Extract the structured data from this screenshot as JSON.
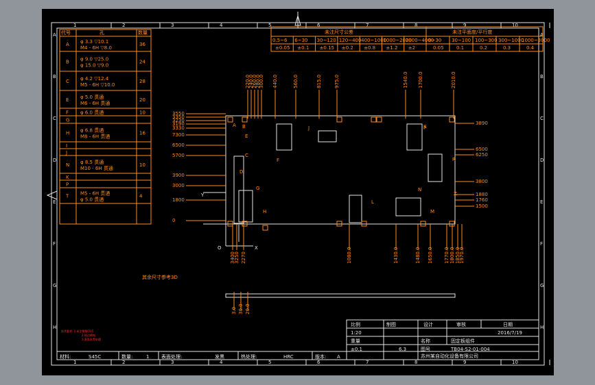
{
  "border": {
    "top_numbers": [
      "1",
      "2",
      "3",
      "4",
      "5",
      "6",
      "7",
      "8",
      "9",
      "10"
    ],
    "side_letters": [
      "A",
      "B",
      "C",
      "D",
      "E",
      "F",
      "G",
      "H"
    ]
  },
  "hole_table": {
    "header": [
      "代号",
      "孔",
      "数量"
    ],
    "rows": [
      {
        "code": "A",
        "spec1": "φ 3.3  ▽10.1",
        "spec2": "M4 - 6H ▽8.0",
        "qty": "36"
      },
      {
        "code": "B",
        "spec1": "φ 9.0  ▽25.0",
        "spec2": "φ 15.0  ▽9.0",
        "qty": "24"
      },
      {
        "code": "C",
        "spec1": "φ 4.2  ▽12.4",
        "spec2": "M5 - 6H ▽10.0",
        "qty": "28"
      },
      {
        "code": "E",
        "spec1": "φ 5.0  贯通",
        "spec2": "M6 - 6H 贯通",
        "qty": "20"
      },
      {
        "code": "F",
        "spec1": "φ 6.0  贯通",
        "spec2": "",
        "qty": "10"
      },
      {
        "code": "G",
        "spec1": "",
        "spec2": "",
        "qty": ""
      },
      {
        "code": "H",
        "spec1": "φ 6.8  贯通",
        "spec2": "M8 - 6H 贯通",
        "qty": "16"
      },
      {
        "code": "I",
        "spec1": "",
        "spec2": "",
        "qty": ""
      },
      {
        "code": "J",
        "spec1": "",
        "spec2": "",
        "qty": ""
      },
      {
        "code": "N",
        "spec1": "φ 8.5  贯通",
        "spec2": "M10 - 6H 贯通",
        "qty": "10"
      },
      {
        "code": "K",
        "spec1": "",
        "spec2": "",
        "qty": ""
      },
      {
        "code": "P",
        "spec1": "",
        "spec2": "",
        "qty": ""
      },
      {
        "code": "T",
        "spec1": "M5 - 6H 贯通",
        "spec2": "φ 5.0  贯通",
        "qty": "4"
      }
    ]
  },
  "tolerance_table": {
    "title1": "未注尺寸公差",
    "title2": "未注平面度/平行度",
    "ranges1": [
      "0.5~6",
      "6~30",
      "30~120",
      "120~400",
      "400~1000",
      "1000~2000",
      "2000~4000"
    ],
    "values1": [
      "±0.05",
      "±0.1",
      "±0.15",
      "±0.2",
      "±0.8",
      "±1.2",
      "±2"
    ],
    "ranges2": [
      "0~30",
      "30~100",
      "100~300",
      "300~1000",
      "1000~3000"
    ],
    "values2": [
      "0.05",
      "0.1",
      "0.2",
      "0.3",
      "0.4"
    ]
  },
  "plan_view": {
    "top_dims": [
      "220.0",
      "240.0",
      "260.0",
      "280.0",
      "300.0",
      "440.0",
      "560.0",
      "815.0",
      "975.0",
      "1540.0",
      "1700.0",
      "2010.0"
    ],
    "left_dims": [
      "3550",
      "3350",
      "3230",
      "3190",
      "3330",
      "7300",
      "6500",
      "5700",
      "3900",
      "3000",
      "1800",
      "0"
    ],
    "right_dims": [
      "3890",
      "6500",
      "6250",
      "3800",
      "1880",
      "1760",
      "1500"
    ],
    "bottom_dims": [
      "3400",
      "3250",
      "2270",
      "1080.0",
      "1430.0",
      "1480.0",
      "1650.0",
      "1770.0",
      "1800.0",
      "1850.0",
      "1970.0"
    ],
    "letters": [
      "A",
      "B",
      "C",
      "D",
      "E",
      "F",
      "G",
      "H",
      "J",
      "K",
      "L",
      "M",
      "N",
      "P",
      "R",
      "Z",
      "Y",
      "O",
      "X"
    ]
  },
  "side_view": {
    "dims": [
      "3.0",
      "30.0",
      "20.0"
    ]
  },
  "notes": {
    "ref_note": "其余尺寸参考3D",
    "red_notes": [
      "技术要求: 1.未注倒角C0.5",
      "2.锐边倒钝",
      "3.表面发黑处理"
    ]
  },
  "title_block": {
    "scale_label": "比例",
    "scale_value": "1:20",
    "draw_label": "制图",
    "check_label": "设计",
    "review_label": "审核",
    "date_label": "日期",
    "date_value": "2016/7/19",
    "weight_label": "重量",
    "name_label": "名称",
    "name_value": "固定板组件",
    "drawing_no_label": "图号",
    "drawing_no_value": "TB04-S2-01-004",
    "company": "苏州某自动化设备有限公司",
    "material_label": "材料:",
    "material_value": "S45C",
    "qty_label": "数量:",
    "qty_value": "1",
    "surface_label": "表面处理:",
    "surface_value": "发黑",
    "heat_label": "热处理:",
    "heat_value": "HRC",
    "version_label": "版本:",
    "version_value": "A",
    "tolerance_value": "±0.1",
    "roughness_value": "6.3"
  }
}
